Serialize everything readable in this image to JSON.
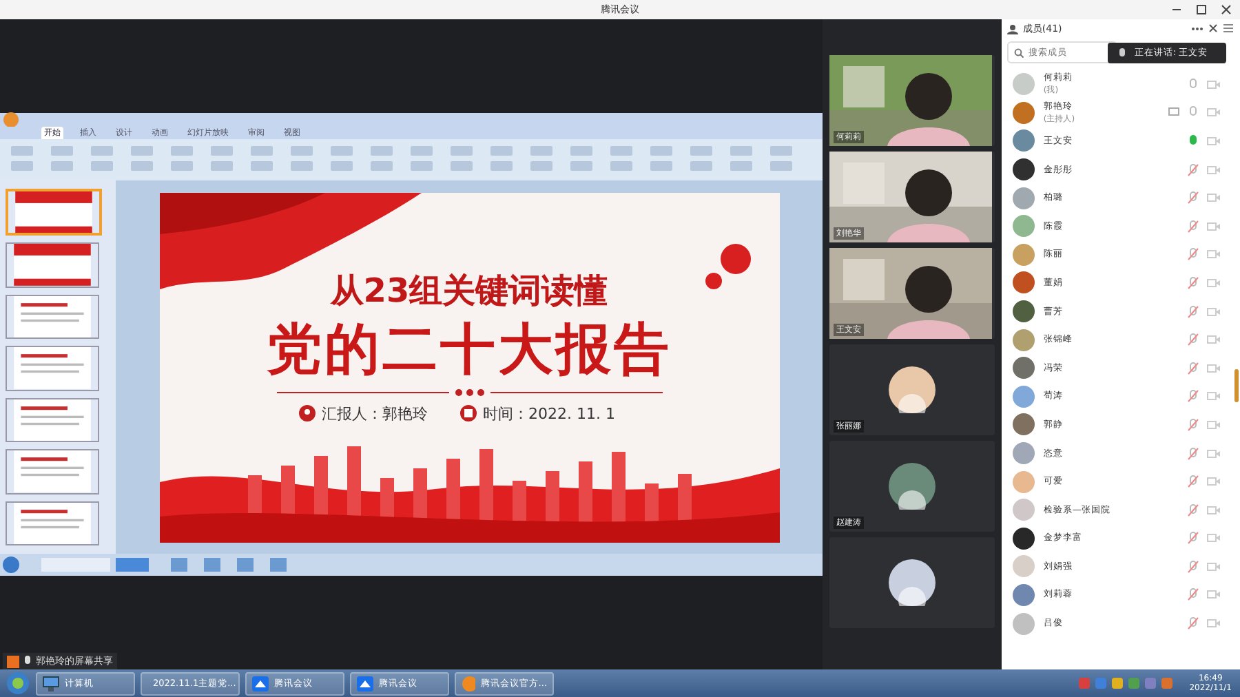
{
  "window": {
    "title": "腾讯会议"
  },
  "share": {
    "label": "郭艳玲的屏幕共享",
    "ppt": {
      "tabs": [
        {
          "label": "开始",
          "selected": true
        },
        {
          "label": "插入",
          "selected": false
        },
        {
          "label": "设计",
          "selected": false
        },
        {
          "label": "动画",
          "selected": false
        },
        {
          "label": "幻灯片放映",
          "selected": false
        },
        {
          "label": "审阅",
          "selected": false
        },
        {
          "label": "视图",
          "selected": false
        }
      ],
      "thumbnails": [
        {
          "selected": true
        },
        {
          "selected": false
        },
        {
          "selected": false
        },
        {
          "selected": false
        },
        {
          "selected": false
        },
        {
          "selected": false
        },
        {
          "selected": false
        }
      ],
      "slide": {
        "subtitle": "从23组关键词读懂",
        "title": "党的二十大报告",
        "reporter": "汇报人：郭艳玲",
        "date": "时间：2022. 11. 1"
      }
    }
  },
  "videos": [
    {
      "kind": "video",
      "name": "何莉莉",
      "color": "#7a9a5a"
    },
    {
      "kind": "video",
      "name": "刘艳华",
      "color": "#d8d4cc"
    },
    {
      "kind": "video",
      "name": "王文安",
      "color": "#b8b0a0"
    },
    {
      "kind": "avatar",
      "name": "张丽娜",
      "color": "#e8c8a8"
    },
    {
      "kind": "avatar",
      "name": "赵建涛",
      "color": "#6a8a7a"
    },
    {
      "kind": "avatar",
      "color": "#c8d0e0"
    }
  ],
  "members": {
    "title": "成员(41)",
    "search": {
      "placeholder": "搜索成员"
    },
    "speaking": "正在讲话: 王文安",
    "items": [
      {
        "name": "何莉莉",
        "role": "(我)",
        "color": "#c8ccc8",
        "muted": false,
        "speaking": false
      },
      {
        "name": "郭艳玲",
        "role": "(主持人)",
        "color": "#c07020",
        "muted": false,
        "speaking": false,
        "sharing": true
      },
      {
        "name": "王文安",
        "color": "#6a8aa0",
        "muted": false,
        "speaking": true
      },
      {
        "name": "金彤彤",
        "color": "#303030",
        "muted": true,
        "speaking": false
      },
      {
        "name": "柏璐",
        "color": "#a0a8b0",
        "muted": true,
        "speaking": false
      },
      {
        "name": "陈霞",
        "color": "#90b890",
        "muted": true,
        "speaking": false
      },
      {
        "name": "陈丽",
        "color": "#c8a060",
        "muted": true,
        "speaking": false
      },
      {
        "name": "董娟",
        "color": "#c05020",
        "muted": true,
        "speaking": false
      },
      {
        "name": "曹芳",
        "color": "#506040",
        "muted": true,
        "speaking": false
      },
      {
        "name": "张锦峰",
        "color": "#b0a070",
        "muted": true,
        "speaking": false
      },
      {
        "name": "冯荣",
        "color": "#707068",
        "muted": true,
        "speaking": false
      },
      {
        "name": "苟涛",
        "color": "#80a8d8",
        "muted": true,
        "speaking": false
      },
      {
        "name": "郭静",
        "color": "#807060",
        "muted": true,
        "speaking": false
      },
      {
        "name": "恣意",
        "color": "#a0a8b8",
        "muted": true,
        "speaking": false
      },
      {
        "name": "可爱",
        "color": "#e8b890",
        "muted": true,
        "speaking": false
      },
      {
        "name": "检验系—张国院",
        "color": "#d0c8c8",
        "muted": true,
        "speaking": false
      },
      {
        "name": "金梦李富",
        "color": "#282828",
        "muted": true,
        "speaking": false
      },
      {
        "name": "刘娟强",
        "color": "#d8d0c8",
        "muted": true,
        "speaking": false
      },
      {
        "name": "刘莉蓉",
        "color": "#7088b0",
        "muted": true,
        "speaking": false
      },
      {
        "name": "吕俊",
        "color": "#c0c0c0",
        "muted": true,
        "speaking": false
      }
    ]
  },
  "taskbar": {
    "items": [
      {
        "label": "计算机",
        "kind": "computer"
      },
      {
        "label": "2022.11.1主题党...",
        "kind": "wps"
      },
      {
        "label": "腾讯会议",
        "kind": "meeting"
      },
      {
        "label": "腾讯会议",
        "kind": "meeting"
      },
      {
        "label": "腾讯会议官方...",
        "kind": "browser"
      }
    ],
    "time": "16:49",
    "date": "2022/11/1"
  }
}
